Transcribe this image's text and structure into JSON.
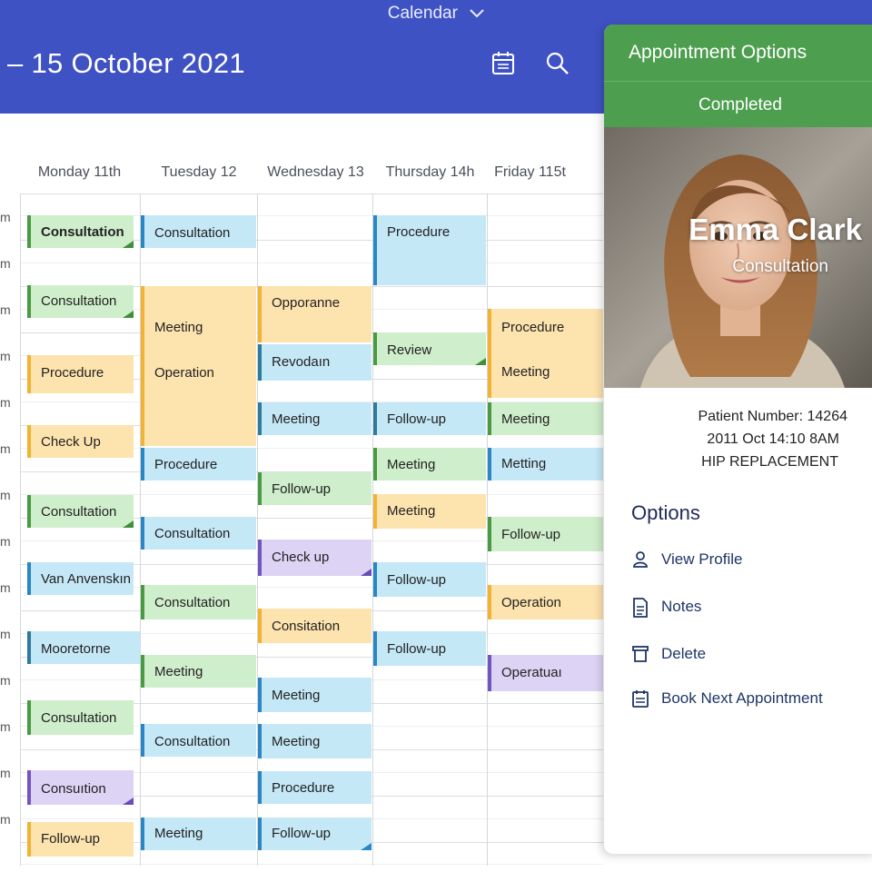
{
  "header": {
    "calendar_switch": "Calendar",
    "date_range": "– 15 October 2021",
    "calendar_icon": "calendar-icon",
    "search_icon": "search-icon",
    "bg_color": "#3f52c4"
  },
  "days": [
    "Monday 11th",
    "Tuesday 12",
    "Wednesday 13",
    "Thursday 14h",
    "Friday 115t"
  ],
  "time_labels": [
    "m",
    "m",
    "m",
    "m",
    "m",
    "m",
    "m",
    "m",
    "m",
    "m",
    "m",
    "m",
    "m",
    "m"
  ],
  "events": {
    "mon": [
      "Consultation",
      "Consultation",
      "Procedure",
      "Check Up",
      "Consultation",
      "Van Anvenskın",
      "Mooretorne",
      "Consultation",
      "Consuıtion",
      "Follow-up"
    ],
    "tue": [
      "Consultation",
      "Meeting",
      "Operation",
      "Procedure",
      "Consultation",
      "Consultation",
      "Meeting",
      "Consultation",
      "Meeting"
    ],
    "wed": [
      "Opporanne",
      "Revodaın",
      "Meeting",
      "Follow-up",
      "Check up",
      "Consitation",
      "Meeting",
      "Meeting",
      "Procedure",
      "Follow-up"
    ],
    "thu": [
      "Procedure",
      "Review",
      "Follow-up",
      "Meeting",
      "Meeting",
      "Follow-up",
      "Follow-up"
    ],
    "fri": [
      "Procedure",
      "Meeting",
      "Meeting",
      "Metting",
      "Follow-up",
      "Operation",
      "Operatuaı"
    ]
  },
  "panel": {
    "title": "Appointment Options",
    "status": "Completed",
    "patient_name": "Emma Clark",
    "service": "Consultation",
    "patient_number": "Patient Number: 14264",
    "datetime": "2011 Oct 14:10 8AM",
    "procedure": "HIP REPLACEMENT",
    "options_title": "Options",
    "options": [
      "View Profile",
      "Notes",
      "Delete",
      "Book Next Appointment"
    ],
    "accent": "#4e9e4f"
  }
}
